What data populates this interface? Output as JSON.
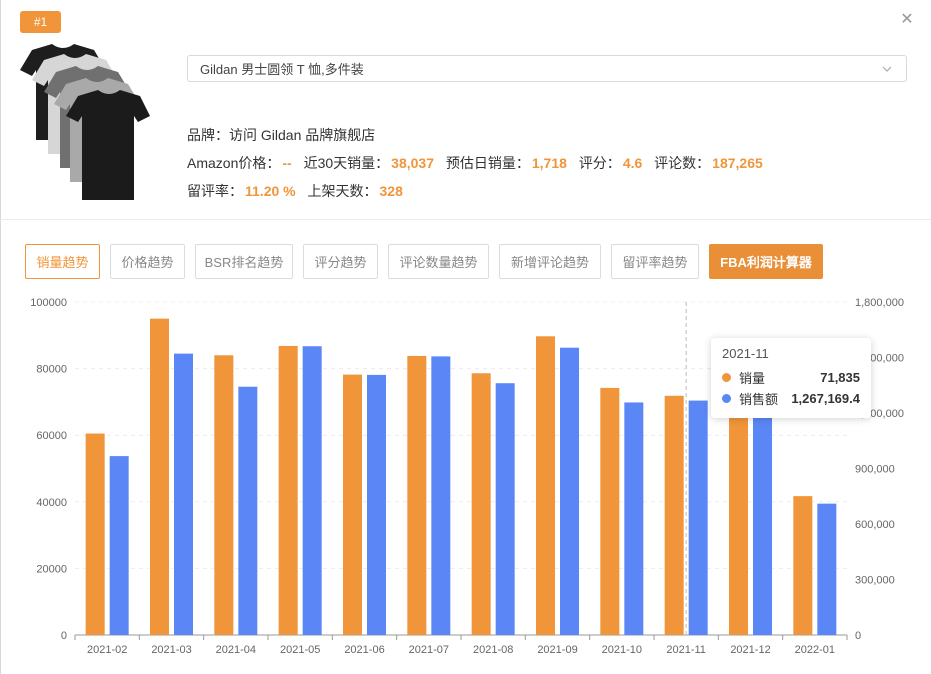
{
  "badge": "#1",
  "product": {
    "title": "Gildan 男士圆领 T 恤,多件装",
    "brand_label": "品牌：",
    "brand_value": "访问 Gildan 品牌旗舰店",
    "price_label": "Amazon价格：",
    "price_value": "--",
    "sales30_label": "近30天销量：",
    "sales30_value": "38,037",
    "daily_label": "预估日销量：",
    "daily_value": "1,718",
    "rating_label": "评分：",
    "rating_value": "4.6",
    "reviews_label": "评论数：",
    "reviews_value": "187,265",
    "review_rate_label": "留评率：",
    "review_rate_value": "11.20 %",
    "days_label": "上架天数：",
    "days_value": "328"
  },
  "tabs": [
    {
      "label": "销量趋势",
      "state": "active"
    },
    {
      "label": "价格趋势",
      "state": "normal"
    },
    {
      "label": "BSR排名趋势",
      "state": "normal"
    },
    {
      "label": "评分趋势",
      "state": "normal"
    },
    {
      "label": "评论数量趋势",
      "state": "normal"
    },
    {
      "label": "新增评论趋势",
      "state": "normal"
    },
    {
      "label": "留评率趋势",
      "state": "normal"
    },
    {
      "label": "FBA利润计算器",
      "state": "primary"
    }
  ],
  "colors": {
    "accent": "#f0953a",
    "sales": "#f0953a",
    "revenue": "#5b86f5"
  },
  "tooltip": {
    "title": "2021-11",
    "rows": [
      {
        "name": "销量",
        "value": "71,835",
        "color": "#f0953a"
      },
      {
        "name": "销售额",
        "value": "1,267,169.4",
        "color": "#5b86f5"
      }
    ]
  },
  "chart_data": {
    "type": "bar",
    "categories": [
      "2021-02",
      "2021-03",
      "2021-04",
      "2021-05",
      "2021-06",
      "2021-07",
      "2021-08",
      "2021-09",
      "2021-10",
      "2021-11",
      "2021-12",
      "2022-01"
    ],
    "series": [
      {
        "name": "销量",
        "axis": "left",
        "values": [
          60500,
          95000,
          84000,
          86800,
          78200,
          83800,
          78600,
          89700,
          74200,
          71835,
          73000,
          41700
        ]
      },
      {
        "name": "销售额",
        "axis": "right",
        "values": [
          967000,
          1521000,
          1342000,
          1561000,
          1406000,
          1506000,
          1361000,
          1553000,
          1257000,
          1267169.4,
          1275000,
          710000
        ]
      }
    ],
    "y_left": {
      "min": 0,
      "max": 100000,
      "ticks": [
        "0",
        "20000",
        "40000",
        "60000",
        "80000",
        "100000"
      ]
    },
    "y_right": {
      "min": 0,
      "max": 1800000,
      "ticks": [
        "0",
        "300,000",
        "600,000",
        "900,000",
        "1,200,000",
        "1,500,000",
        "1,800,000"
      ]
    },
    "highlight_category": "2021-11",
    "grid": true
  }
}
